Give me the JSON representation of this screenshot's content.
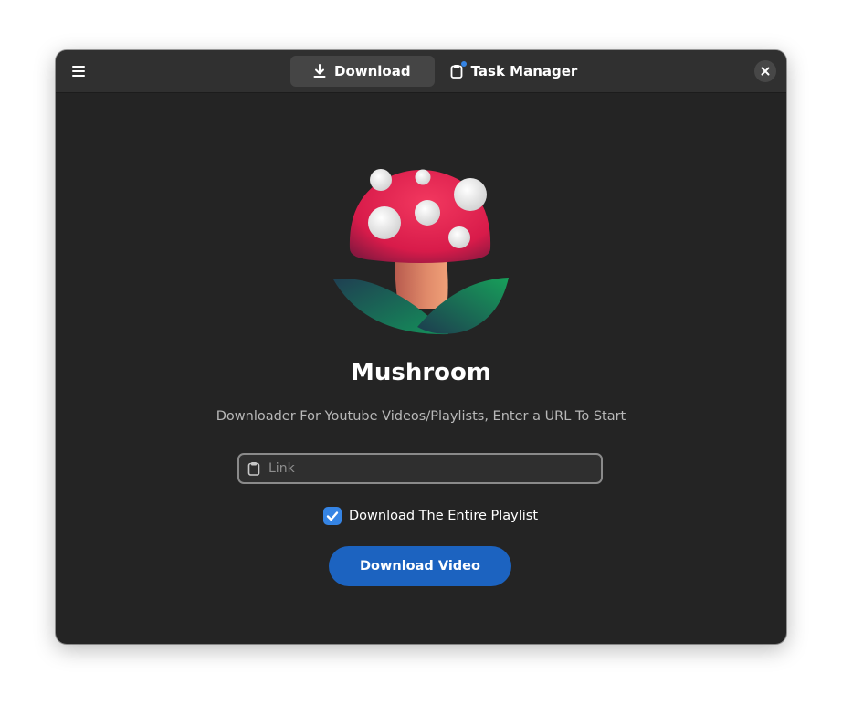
{
  "header": {
    "menu_icon": "hamburger-menu-icon",
    "tabs": [
      {
        "label": "Download",
        "icon": "download-icon",
        "active": true
      },
      {
        "label": "Task Manager",
        "icon": "clipboard-icon",
        "active": false,
        "badge": true
      }
    ],
    "close_icon": "close-icon"
  },
  "main": {
    "logo_icon": "mushroom-logo",
    "title": "Mushroom",
    "subtitle": "Downloader For Youtube Videos/Playlists, Enter a URL To Start",
    "link_input": {
      "placeholder": "Link",
      "value": "",
      "icon": "clipboard-icon"
    },
    "playlist_checkbox": {
      "label": "Download The Entire Playlist",
      "checked": true
    },
    "download_button": "Download Video"
  },
  "colors": {
    "window_bg": "#242424",
    "header_bg": "#303030",
    "accent": "#3584e4",
    "button": "#1c63c0",
    "mushroom_cap": "#e6204e",
    "leaf": "#1a8a4e"
  }
}
